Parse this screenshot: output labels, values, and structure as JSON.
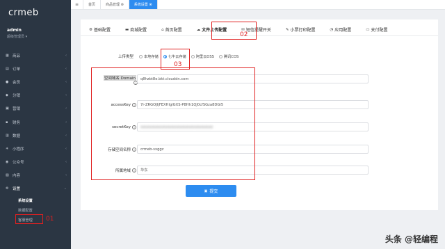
{
  "sidebar": {
    "logo": "crmeb",
    "user_name": "admin",
    "user_role": "超级管理员 ▾",
    "items": [
      {
        "icon": "cart-icon",
        "glyph": "▦",
        "label": "商品",
        "arrow": "‹"
      },
      {
        "icon": "order-icon",
        "glyph": "▤",
        "label": "订单",
        "arrow": "‹"
      },
      {
        "icon": "user-icon",
        "glyph": "●",
        "label": "会员",
        "arrow": "‹"
      },
      {
        "icon": "share-icon",
        "glyph": "◆",
        "label": "分销",
        "arrow": "‹"
      },
      {
        "icon": "marketing-icon",
        "glyph": "▣",
        "label": "营销",
        "arrow": "‹"
      },
      {
        "icon": "finance-icon",
        "glyph": "▪",
        "label": "财务",
        "arrow": "‹"
      },
      {
        "icon": "data-icon",
        "glyph": "▥",
        "label": "数据",
        "arrow": "‹"
      },
      {
        "icon": "miniapp-icon",
        "glyph": "✳",
        "label": "小程序",
        "arrow": "‹"
      },
      {
        "icon": "wechat-icon",
        "glyph": "◉",
        "label": "公众号",
        "arrow": "‹"
      },
      {
        "icon": "content-icon",
        "glyph": "▧",
        "label": "内容",
        "arrow": "‹"
      },
      {
        "icon": "settings-icon",
        "glyph": "⚙",
        "label": "设置",
        "arrow": "⌄"
      }
    ],
    "sub_items": [
      "系统设置",
      "数据配置",
      "客服管理"
    ]
  },
  "topbar": {
    "menu_glyph": "≡",
    "tags": [
      "首页",
      "商品管理 ⊗",
      "系统设置 ⊗"
    ]
  },
  "tabs": [
    {
      "icon": "gear-icon",
      "glyph": "⚙",
      "label": "基础配置"
    },
    {
      "icon": "store-icon",
      "glyph": "▬",
      "label": "商城配置"
    },
    {
      "icon": "home-icon",
      "glyph": "⌂",
      "label": "首页配置"
    },
    {
      "icon": "cloud-upload-icon",
      "glyph": "☁",
      "label": "文件上传配置"
    },
    {
      "icon": "sms-icon",
      "glyph": "✉",
      "label": "短信提醒开关"
    },
    {
      "icon": "printer-icon",
      "glyph": "✎",
      "label": "小票打印配置"
    },
    {
      "icon": "wechat-icon",
      "glyph": "◔",
      "label": "应用配置"
    },
    {
      "icon": "payment-icon",
      "glyph": "▭",
      "label": "支付配置"
    }
  ],
  "form": {
    "upload_type_label": "上传类型",
    "upload_options": [
      "本地存储",
      "七牛云存储",
      "阿里云OSS",
      "腾讯COS"
    ],
    "selected_option": "七牛云存储",
    "fields": [
      {
        "label": "空间域名 Domain",
        "value": "q8hzbt8e.bkt.clouddn.com"
      },
      {
        "label": "accessKey",
        "value": "7r-ZRGOJIjFEXHlglGXS-P8Hh1QJ0cfSGza8DGi5"
      },
      {
        "label": "secretKey",
        "value": "xxxxxxxxxxxxxxxxxxxxxxxxxxxxxxxxxx"
      },
      {
        "label": "存储空间名称",
        "value": "crmeb-sxggz"
      },
      {
        "label": "所属地域",
        "value": "华东"
      }
    ],
    "info_glyph": "i",
    "submit_label": "提交",
    "submit_glyph": "▣"
  },
  "annotations": [
    "01",
    "02",
    "03"
  ],
  "watermark": "头条 @轻编程"
}
